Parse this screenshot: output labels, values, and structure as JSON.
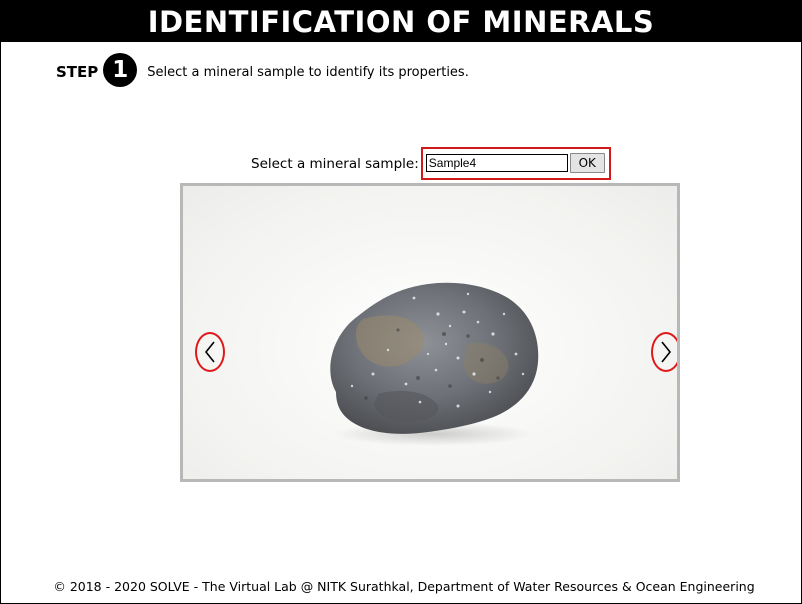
{
  "header": {
    "title": "IDENTIFICATION OF MINERALS"
  },
  "step": {
    "word": "STEP",
    "number": "1",
    "instruction": "Select a mineral sample to identify its properties."
  },
  "sample_selector": {
    "label": "Select a mineral sample:",
    "value": "Sample4",
    "ok_label": "OK"
  },
  "viewer": {
    "image_subject": "mineral-sample-rock",
    "prev_icon": "chevron-left-icon",
    "next_icon": "chevron-right-icon",
    "highlight_color": "#e01818"
  },
  "footer": {
    "text": "© 2018 - 2020 SOLVE - The Virtual Lab @ NITK Surathkal, Department of Water Resources & Ocean Engineering"
  }
}
